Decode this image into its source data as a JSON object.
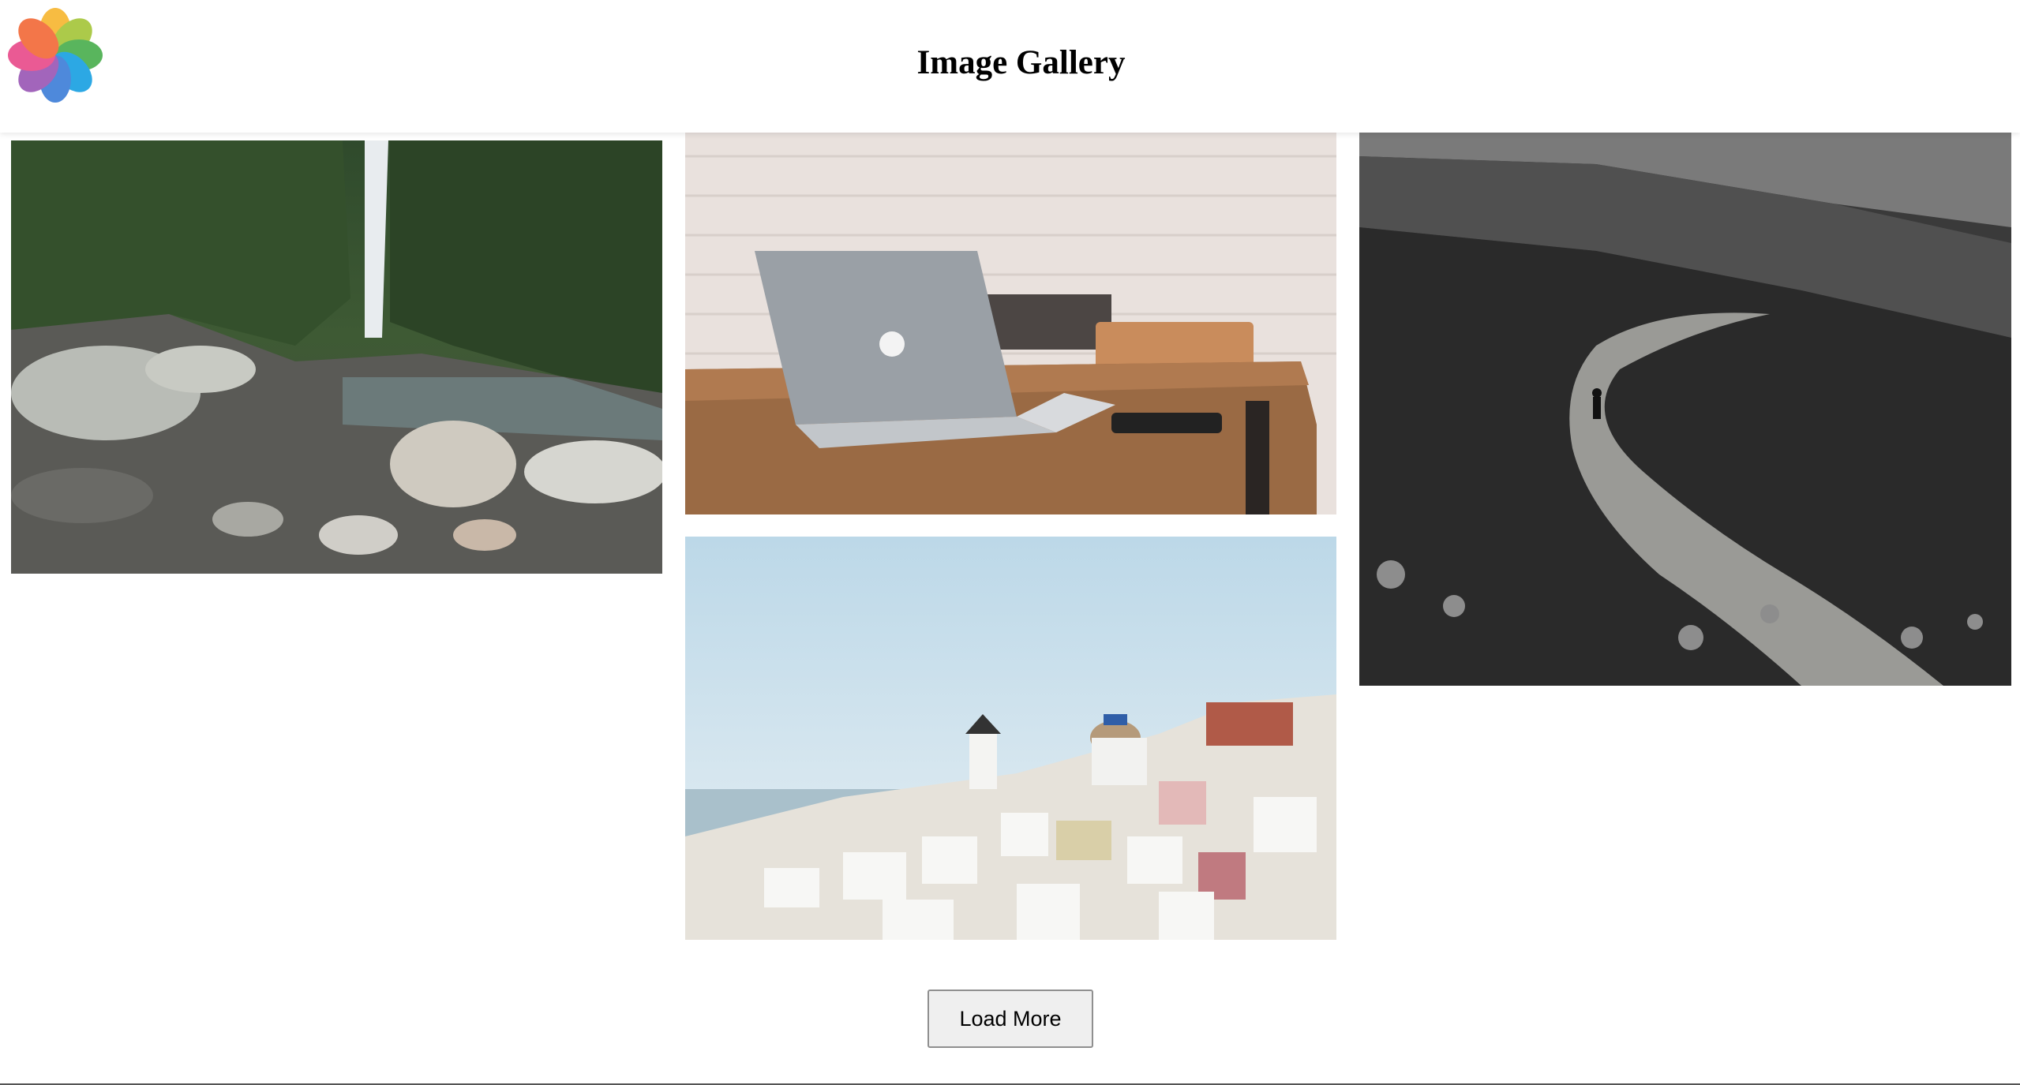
{
  "header": {
    "title": "Image Gallery",
    "logo_icon": "photos-flower-logo",
    "logo_colors": [
      "#f7b733",
      "#a5c63b",
      "#4caf50",
      "#1ba1e2",
      "#3f7fd8",
      "#9b59b6",
      "#e94d8c",
      "#f26b3a"
    ]
  },
  "gallery": {
    "images": [
      {
        "subject": "waterfall-canyon"
      },
      {
        "subject": "laptop-on-desk"
      },
      {
        "subject": "santorini-village"
      },
      {
        "subject": "mountain-trail-bw"
      }
    ]
  },
  "actions": {
    "load_more_label": "Load More"
  }
}
